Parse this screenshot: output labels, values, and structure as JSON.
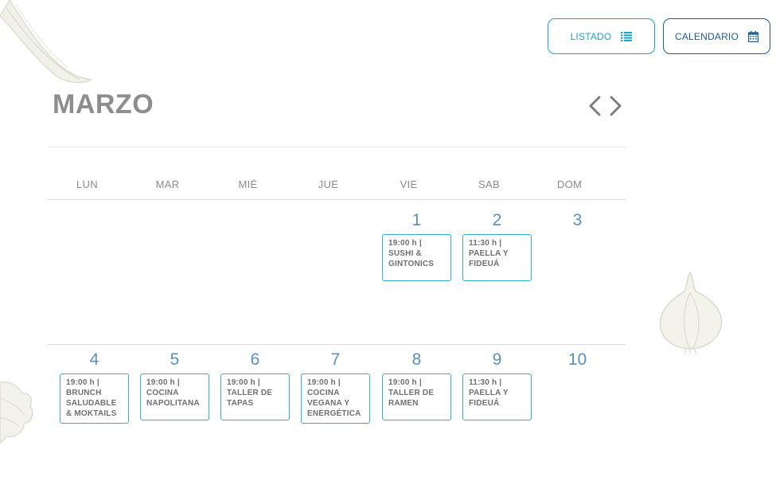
{
  "view_toggle": {
    "listado_label": "LISTADO",
    "calendario_label": "CALENDARIO"
  },
  "calendar": {
    "month": "MARZO",
    "weekdays": [
      "LUN",
      "MAR",
      "MIÉ",
      "JUE",
      "VIE",
      "SAB",
      "DOM"
    ],
    "weeks": [
      {
        "days": [
          {
            "num": "1",
            "event": {
              "time": "19:00 h  |",
              "title": "SUSHI & GINTONICS"
            }
          },
          {
            "num": "2",
            "event": {
              "time": "11:30 h  |",
              "title": "PAELLA Y FIDEUÁ"
            }
          },
          {
            "num": "3"
          }
        ]
      },
      {
        "days": [
          {
            "num": "4",
            "event": {
              "time": "19:00 h  |",
              "title": "BRUNCH SALUDABLE & MOKTAILS"
            }
          },
          {
            "num": "5",
            "event": {
              "time": "19:00 h  |",
              "title": "COCINA NAPOLITANA"
            }
          },
          {
            "num": "6",
            "event": {
              "time": "19:00 h  |",
              "title": "TALLER DE TAPAS"
            }
          },
          {
            "num": "7",
            "event": {
              "time": "19:00 h  |",
              "title": "COCINA VEGANA Y ENERGÉTICA"
            }
          },
          {
            "num": "8",
            "event": {
              "time": "19:00 h  |",
              "title": "TALLER DE RAMEN"
            }
          },
          {
            "num": "9",
            "event": {
              "time": "11:30 h  |",
              "title": "PAELLA Y FIDEUÁ"
            }
          },
          {
            "num": "10"
          }
        ]
      }
    ]
  },
  "colors": {
    "accent_cyan": "#1aa3c9",
    "accent_navy": "#1e5b93",
    "day_number": "#5a8fbf",
    "title_gray": "#8d8d8d"
  },
  "icons": {
    "listado": "list-icon",
    "calendario": "calendar-icon",
    "prev": "chevron-left-icon",
    "next": "chevron-right-icon"
  }
}
